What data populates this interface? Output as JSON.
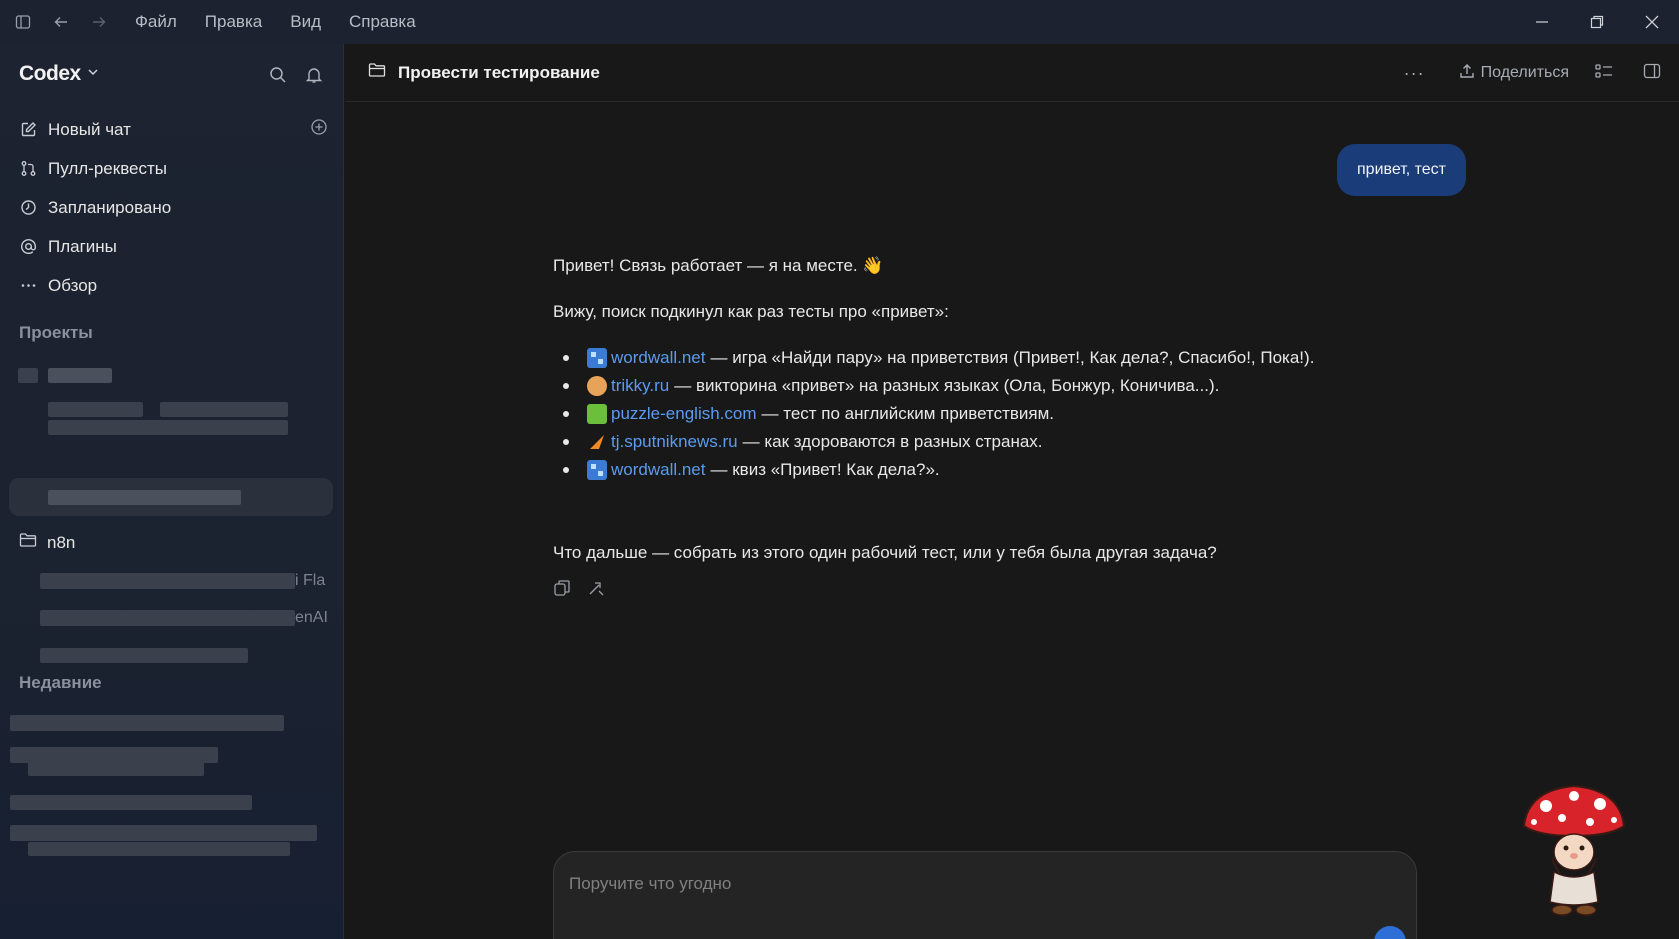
{
  "menu": {
    "items": [
      "Файл",
      "Правка",
      "Вид",
      "Справка"
    ]
  },
  "sidebar": {
    "brand": "Codex",
    "nav": [
      {
        "label": "Новый чат",
        "icon": "edit-icon"
      },
      {
        "label": "Пулл-реквесты",
        "icon": "git-pull-request-icon"
      },
      {
        "label": "Запланировано",
        "icon": "clock-icon"
      },
      {
        "label": "Плагины",
        "icon": "at-icon"
      },
      {
        "label": "Обзор",
        "icon": "more-dots-icon"
      }
    ],
    "projects_title": "Проекты",
    "folder_label": "n8n",
    "fragment_1": "i Fla",
    "fragment_2": "enAI",
    "recent_title": "Недавние"
  },
  "header": {
    "title": "Провести тестирование",
    "share_label": "Поделиться"
  },
  "chat": {
    "user_message": "привет, тест",
    "intro": "Привет! Связь работает — я на месте. 👋",
    "lead": "Вижу, поиск подкинул как раз тесты про «привет»:",
    "results": [
      {
        "site": "wordwall.net",
        "desc": "— игра «Найди пару» на приветствия (Привет!, Как дела?, Спасибо!, Пока!).",
        "favicon": "wordwall-icon",
        "color": "#3a7bd5"
      },
      {
        "site": "trikky.ru",
        "desc": "— викторина «привет» на разных языках (Ола, Бонжур, Коничива...).",
        "favicon": "trikky-icon",
        "color": "#e8a35a"
      },
      {
        "site": "puzzle-english.com",
        "desc": "— тест по английским приветствиям.",
        "favicon": "puzzle-icon",
        "color": "#6bbf3a"
      },
      {
        "site": "tj.sputniknews.ru",
        "desc": "— как здороваются в разных странах.",
        "favicon": "sputnik-icon",
        "color": "#f08a24"
      },
      {
        "site": "wordwall.net",
        "desc": "— квиз «Привет! Как дела?».",
        "favicon": "wordwall-icon",
        "color": "#3a7bd5"
      }
    ],
    "closing": "Что дальше — собрать из этого один рабочий тест, или у тебя была другая задача?"
  },
  "composer": {
    "placeholder": "Поручите что угодно"
  },
  "colors": {
    "user_bubble": "#1a3c78",
    "link": "#5b9bf0",
    "send_button": "#2d6fd6"
  }
}
